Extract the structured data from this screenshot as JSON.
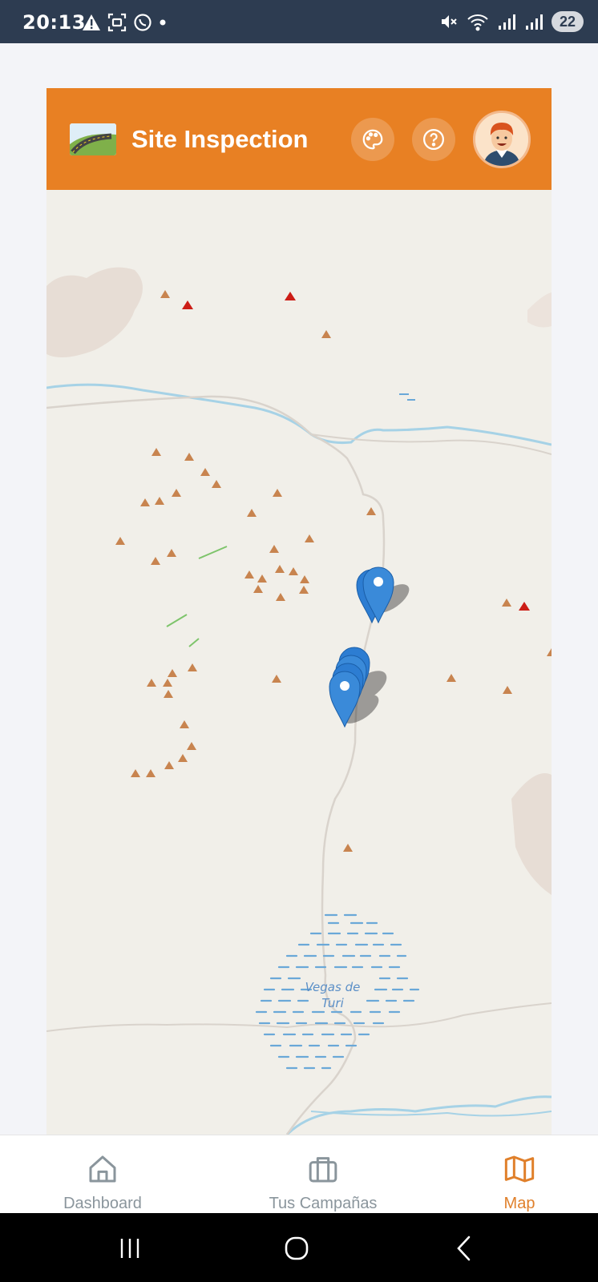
{
  "status_bar": {
    "time": "20:13",
    "battery": "22",
    "background": "#2d3c51"
  },
  "header": {
    "title": "Site Inspection",
    "background": "#e88023",
    "theme_icon": "palette-icon",
    "help_icon": "help-circle-icon"
  },
  "map": {
    "place_label_line1": "Vegas de",
    "place_label_line2": "Turi",
    "marker_color": "#2d7dd2",
    "land_color": "#f1efe9",
    "water_color": "#8fc5e0"
  },
  "bottom_nav": {
    "items": [
      {
        "label": "Dashboard",
        "icon": "home-icon",
        "active": false
      },
      {
        "label": "Tus Campañas",
        "icon": "briefcase-icon",
        "active": false
      },
      {
        "label": "Map",
        "icon": "map-icon",
        "active": true
      }
    ],
    "active_color": "#e0802b",
    "inactive_color": "#8a959c"
  }
}
